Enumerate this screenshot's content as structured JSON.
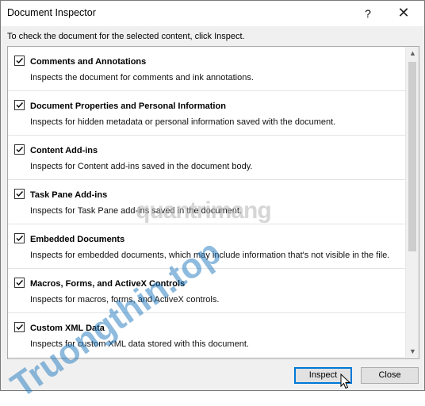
{
  "window": {
    "title": "Document Inspector",
    "help_glyph": "?",
    "close_glyph": "✕"
  },
  "instruction": "To check the document for the selected content, click Inspect.",
  "items": [
    {
      "label": "Comments and Annotations",
      "description": "Inspects the document for comments and ink annotations.",
      "checked": true
    },
    {
      "label": "Document Properties and Personal Information",
      "description": "Inspects for hidden metadata or personal information saved with the document.",
      "checked": true
    },
    {
      "label": "Content Add-ins",
      "description": "Inspects for Content add-ins saved in the document body.",
      "checked": true
    },
    {
      "label": "Task Pane Add-ins",
      "description": "Inspects for Task Pane add-ins saved in the document.",
      "checked": true
    },
    {
      "label": "Embedded Documents",
      "description": "Inspects for embedded documents, which may include information that's not visible in the file.",
      "checked": true
    },
    {
      "label": "Macros, Forms, and ActiveX Controls",
      "description": "Inspects for macros, forms, and ActiveX controls.",
      "checked": true
    },
    {
      "label": "Custom XML Data",
      "description": "Inspects for custom XML data stored with this document.",
      "checked": true
    }
  ],
  "buttons": {
    "inspect": "Inspect",
    "close": "Close"
  },
  "watermarks": {
    "primary": "quantrimang",
    "secondary": "Truongthin.top"
  },
  "colors": {
    "accent": "#0078d7",
    "checkmark": "#000000"
  }
}
